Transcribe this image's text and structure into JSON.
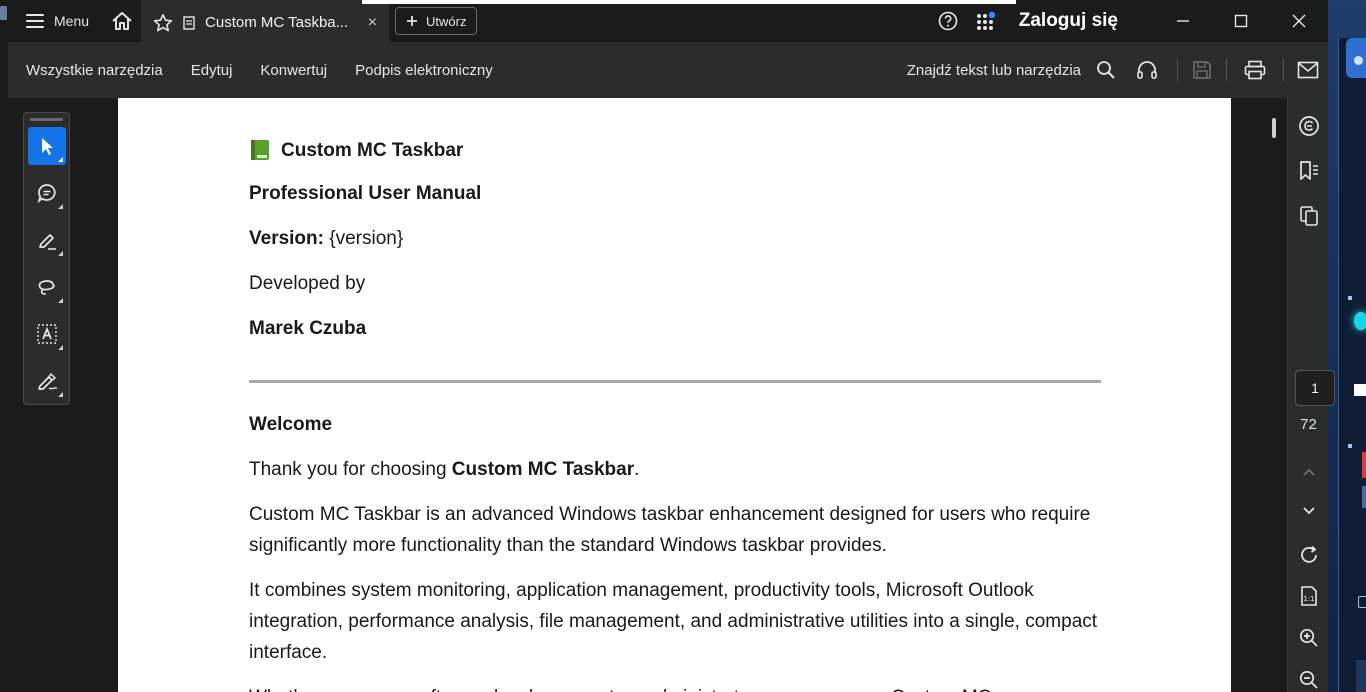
{
  "tabbar": {
    "menu_label": "Menu",
    "tab_title": "Custom MC Taskba...",
    "tab_close": "×",
    "new_label": "Utwórz",
    "login_label": "Zaloguj się"
  },
  "menubar": {
    "items": [
      "Wszystkie narzędzia",
      "Edytuj",
      "Konwertuj",
      "Podpis elektroniczny"
    ],
    "search_label": "Znajdź tekst lub narzędzia"
  },
  "document": {
    "title": "Custom MC Taskbar",
    "subtitle": "Professional User Manual",
    "version_label": "Version:",
    "version_value": " {version}",
    "developed_by": "Developed by",
    "author": "Marek Czuba",
    "welcome_heading": "Welcome",
    "thanks_prefix": "Thank you for choosing ",
    "thanks_bold": "Custom MC Taskbar",
    "thanks_suffix": ".",
    "para1": "Custom MC Taskbar is an advanced Windows taskbar enhancement designed for users who require significantly more functionality than the standard Windows taskbar provides.",
    "para2": "It combines system monitoring, application management, productivity tools, Microsoft Outlook integration, performance analysis, file management, and administrative utilities into a single, compact interface.",
    "para3_partial": "Whether you are a software developer, system administrator, or power user, Custom MC"
  },
  "pager": {
    "current_page": "1",
    "total_pages": "72"
  },
  "colors": {
    "accent": "#1473e6",
    "chrome_dark": "#1b1b1b",
    "chrome_mid": "#2c2c2c"
  },
  "icons": {
    "home": "home-icon",
    "star": "star-icon",
    "help": "help-icon",
    "apps": "apps-grid-icon",
    "search": "search-icon",
    "audio": "headphones-icon",
    "save": "save-icon",
    "print": "print-icon",
    "mail": "mail-icon"
  }
}
